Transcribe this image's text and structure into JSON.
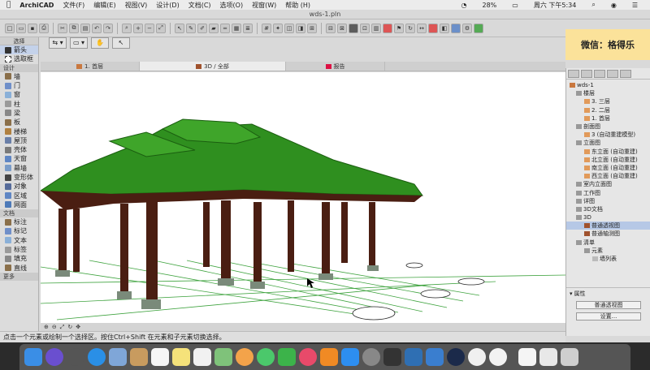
{
  "menubar": {
    "apple": "",
    "app": "ArchiCAD",
    "items": [
      "文件(F)",
      "编辑(E)",
      "视图(V)",
      "设计(D)",
      "文档(C)",
      "选项(O)",
      "视窗(W)",
      "帮助 (H)"
    ],
    "battery": "28%",
    "clock": "周六 下午5:34"
  },
  "window": {
    "title": "wds-1.pln"
  },
  "toolbox": {
    "header": "选择",
    "arrow": "箭头",
    "marquee": "选取框",
    "design_header": "设计",
    "design_items": [
      "墙",
      "门",
      "窗",
      "柱",
      "梁",
      "板",
      "楼梯",
      "屋顶",
      "壳体",
      "天窗",
      "幕墙",
      "变形体",
      "对象",
      "区域",
      "网面"
    ],
    "doc_header": "文档",
    "doc_items": [
      "标注",
      "标记",
      "文本",
      "标签",
      "填充",
      "直线"
    ],
    "more": "更多"
  },
  "wechat_label": "微信：格得乐",
  "tabs": [
    {
      "label": "1. 首层"
    },
    {
      "label": "3D / 全部"
    },
    {
      "label": "报告"
    }
  ],
  "navigator": {
    "root": "wds-1",
    "stories_header": "楼层",
    "stories": [
      "3. 三层",
      "2. 二层",
      "1. 首层"
    ],
    "sections_header": "剖面图",
    "sections": [
      "3 (自动重建模型)"
    ],
    "elevations_header": "立面图",
    "elevations": [
      "东立面 (自动重建)",
      "北立面 (自动重建)",
      "南立面 (自动重建)",
      "西立面 (自动重建)"
    ],
    "others": [
      "室内立面图",
      "工作图",
      "详图",
      "3D文档"
    ],
    "threed_header": "3D",
    "threed": [
      "普通透视图",
      "普通轴测图"
    ],
    "lists_header": "清单",
    "lists_sub": "元素",
    "lists_items": [
      "墙列表"
    ],
    "properties_label": "属性",
    "view_button": "普通透视图",
    "settings_button": "设置..."
  },
  "status": "点击一个元素或绘制一个选择区。按住Ctrl+Shift 在元素和子元素切换选择。",
  "colors": {
    "roof": "#2f8f1f",
    "column": "#4a1e12",
    "base": "#7a8a7a",
    "grid": "#3fa33f"
  }
}
